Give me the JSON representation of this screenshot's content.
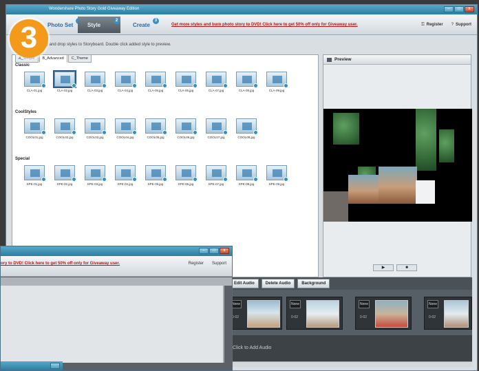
{
  "window": {
    "title": "Wondershare Photo Story Gold Giveaway Edition",
    "controls": [
      "–",
      "□",
      "x"
    ]
  },
  "big_step_number": "3",
  "steps": [
    {
      "label": "Photo Set",
      "badge": "1"
    },
    {
      "label": "Style",
      "badge": "2"
    },
    {
      "label": "Create",
      "badge": "3"
    }
  ],
  "promo": "Get more styles and burn photo story to DVD! Click here to get 50% off only for Giveaway user.",
  "top_links": {
    "register": "Register",
    "support": "Support"
  },
  "hint": "Drag and drop styles to Storyboard. Double click added style to preview.",
  "style_tabs": [
    "A_Simple",
    "B_Advanced",
    "C_Theme"
  ],
  "sections": [
    {
      "name": "Classic",
      "items": [
        "CLA-01.jpg",
        "CLA-02.jpg",
        "CLA-03.jpg",
        "CLA-04.jpg",
        "CLA-05.jpg",
        "CLA-06.jpg",
        "CLA-07.jpg",
        "CLA-08.jpg",
        "CLA-09.jpg"
      ]
    },
    {
      "name": "CoolStyles",
      "items": [
        "COOL01.jpg",
        "COOL02.jpg",
        "COOL03.jpg",
        "COOL04.jpg",
        "COOL05.jpg",
        "COOL06.jpg",
        "COOL07.jpg",
        "COOL08.jpg"
      ]
    },
    {
      "name": "Special",
      "items": [
        "SPE-01.jpg",
        "SPE-02.jpg",
        "SPE-03.jpg",
        "SPE-04.jpg",
        "SPE-05.jpg",
        "SPE-06.jpg",
        "SPE-07.jpg",
        "SPE-08.jpg",
        "SPE-09.jpg"
      ]
    }
  ],
  "preview": {
    "title": "Preview",
    "play": "▶",
    "stop": "■"
  },
  "storyboard": {
    "buttons": [
      "Edit Audio",
      "Delete Audio",
      "Background"
    ],
    "frames": [
      {
        "none": "None",
        "num": "0-02"
      },
      {
        "none": "None",
        "num": "0-02"
      },
      {
        "none": "None",
        "num": "0-02"
      },
      {
        "none": "None",
        "num": "0-02"
      }
    ],
    "audio_hint": "Click to Add Audio"
  },
  "window2": {
    "promo": "ory to DVD! Click here to get 50% off only for Giveaway user.",
    "register": "Register",
    "support": "Support"
  },
  "colors": {
    "accent": "#2b7ea3",
    "promo": "#b01818",
    "step_badge": "#f39a1a"
  }
}
